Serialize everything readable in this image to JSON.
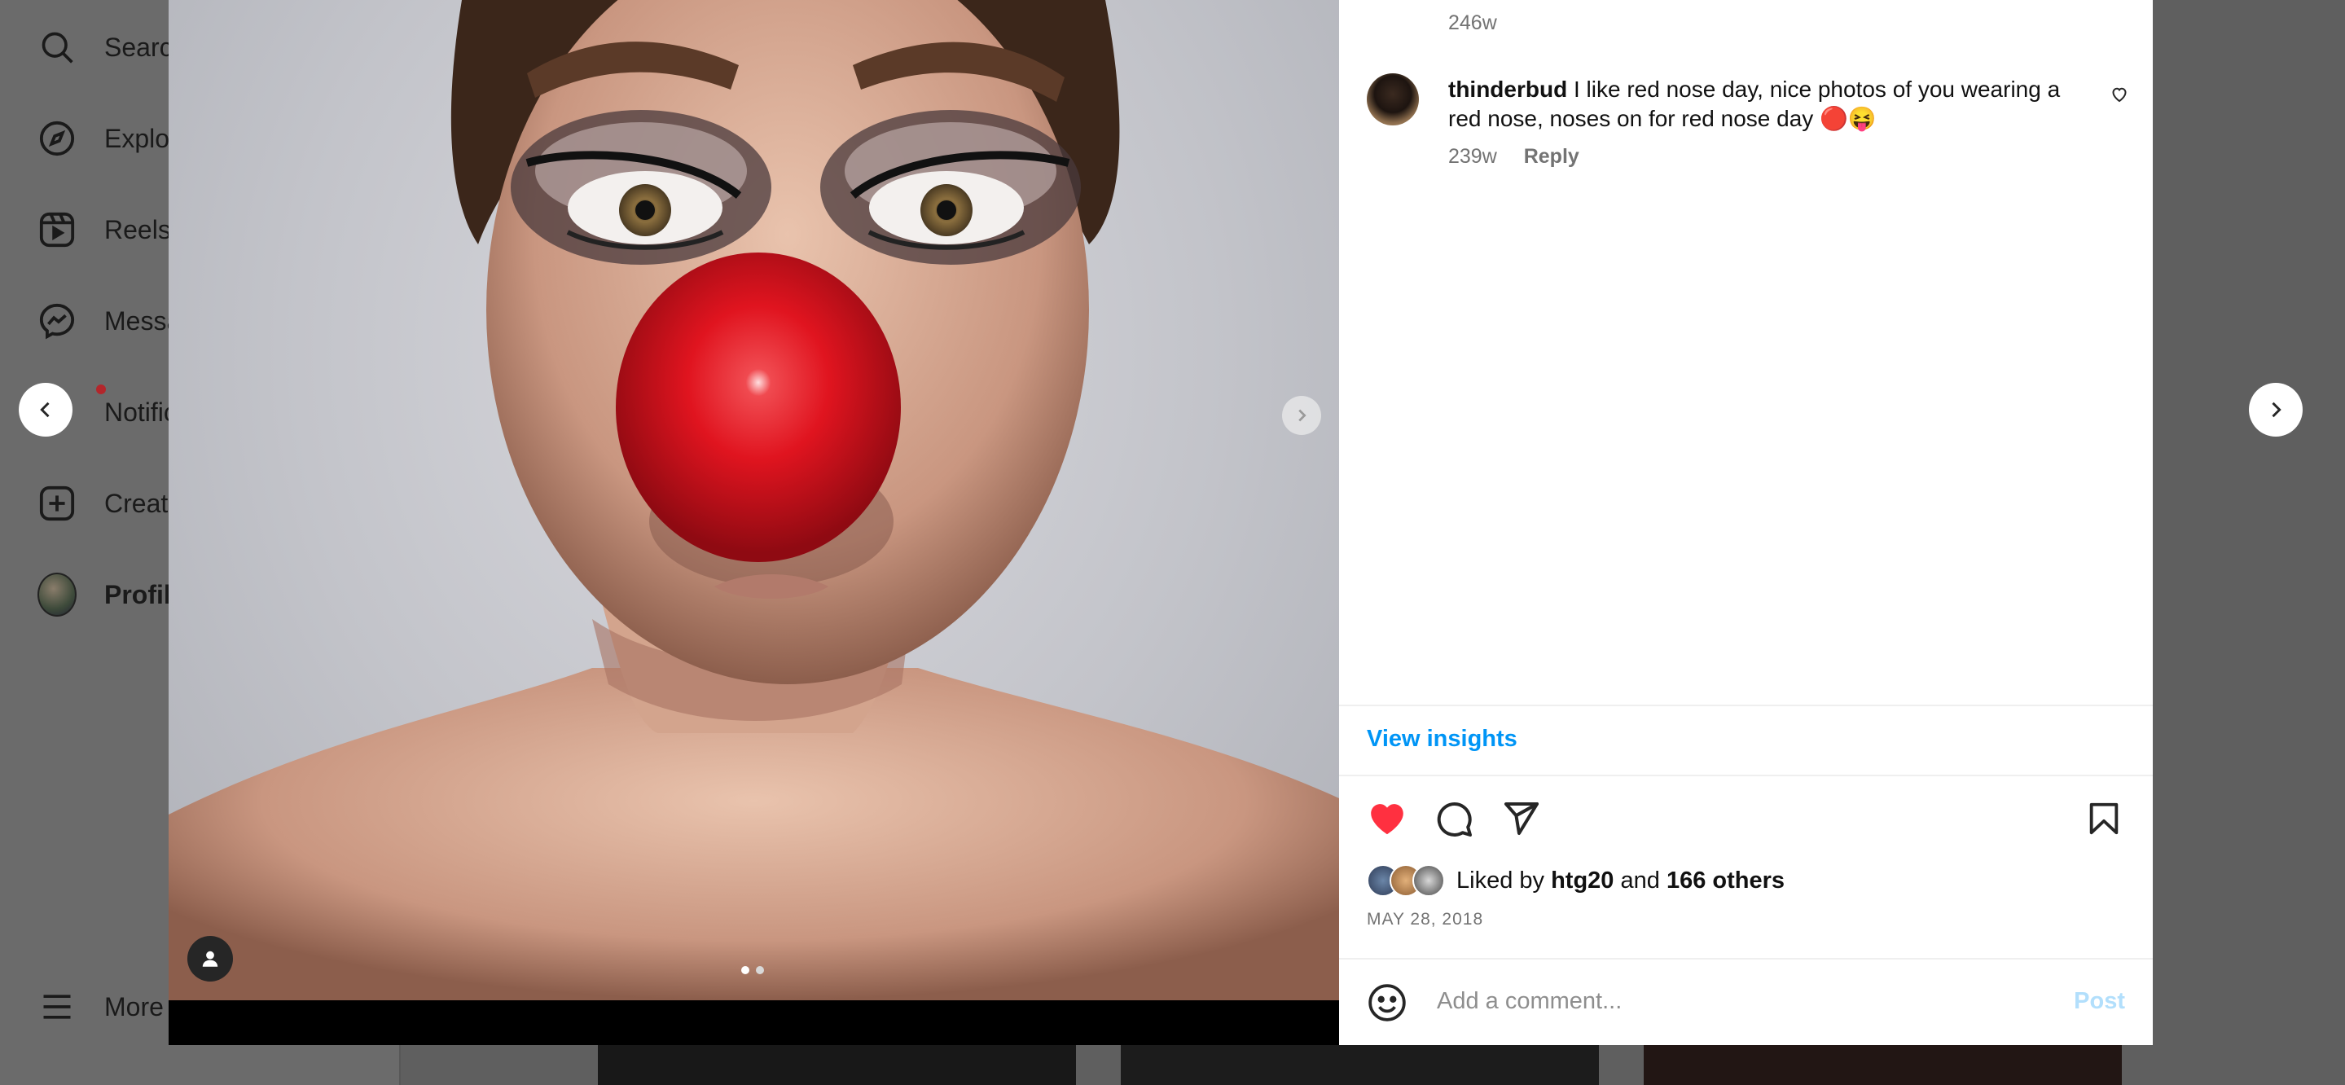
{
  "sidebar": {
    "items": [
      {
        "label": "Search",
        "icon": "search-icon"
      },
      {
        "label": "Explore",
        "icon": "compass-icon"
      },
      {
        "label": "Reels",
        "icon": "reels-icon"
      },
      {
        "label": "Messages",
        "icon": "messenger-icon"
      },
      {
        "label": "Notifications",
        "icon": "heart-icon"
      },
      {
        "label": "Create",
        "icon": "plus-square-icon"
      },
      {
        "label": "Profile",
        "icon": "avatar"
      }
    ],
    "more_label": "More"
  },
  "post": {
    "carousel": {
      "total": 2,
      "active": 1
    },
    "comments": [
      {
        "username": "thinderbud",
        "text": "I like red nose day, nice photos of you wearing a red nose, noses on for red nose day 🔴😝",
        "time": "239w",
        "reply_label": "Reply"
      }
    ],
    "previous_time": "246w",
    "insights_label": "View insights",
    "liked": true,
    "likes": {
      "prefix": "Liked by",
      "user": "htg20",
      "and": "and",
      "others": "166 others"
    },
    "date": "MAY 28, 2018",
    "comment_placeholder": "Add a comment...",
    "post_label": "Post"
  },
  "colors": {
    "like_red": "#ff3040",
    "link_blue": "#0095f6",
    "post_disabled": "#b2dffc",
    "nose_red": "#e0141f"
  }
}
